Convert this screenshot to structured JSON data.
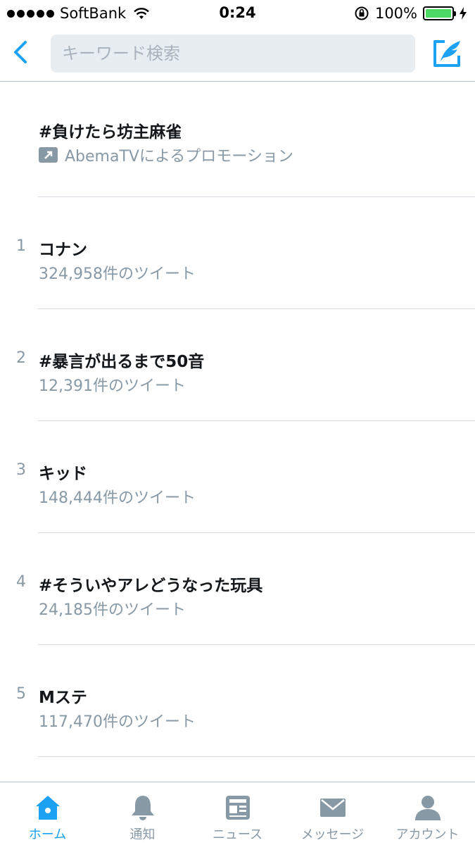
{
  "status_bar": {
    "carrier": "SoftBank",
    "time": "0:24",
    "battery_percent": "100%",
    "battery_level": 1.0
  },
  "header": {
    "search_placeholder": "キーワード検索",
    "back_icon": "chevron-left-icon",
    "compose_icon": "compose-tweet-icon"
  },
  "promoted": {
    "title": "#負けたら坊主麻雀",
    "promoted_by": "AbemaTVによるプロモーション",
    "icon": "promoted-arrow-icon"
  },
  "trends": [
    {
      "rank": "1",
      "title": "コナン",
      "count": "324,958件のツイート"
    },
    {
      "rank": "2",
      "title": "#暴言が出るまで50音",
      "count": "12,391件のツイート"
    },
    {
      "rank": "3",
      "title": "キッド",
      "count": "148,444件のツイート"
    },
    {
      "rank": "4",
      "title": "#そういやアレどうなった玩具",
      "count": "24,185件のツイート"
    },
    {
      "rank": "5",
      "title": "Mステ",
      "count": "117,470件のツイート"
    }
  ],
  "tabs": [
    {
      "label": "ホーム",
      "icon": "home-icon",
      "active": true
    },
    {
      "label": "通知",
      "icon": "bell-icon",
      "active": false
    },
    {
      "label": "ニュース",
      "icon": "news-icon",
      "active": false
    },
    {
      "label": "メッセージ",
      "icon": "envelope-icon",
      "active": false
    },
    {
      "label": "アカウント",
      "icon": "person-icon",
      "active": false
    }
  ],
  "colors": {
    "accent": "#1da1f2",
    "muted": "#8899a6",
    "text": "#14171a",
    "search_bg": "#e8edf2",
    "battery": "#4cd964"
  }
}
